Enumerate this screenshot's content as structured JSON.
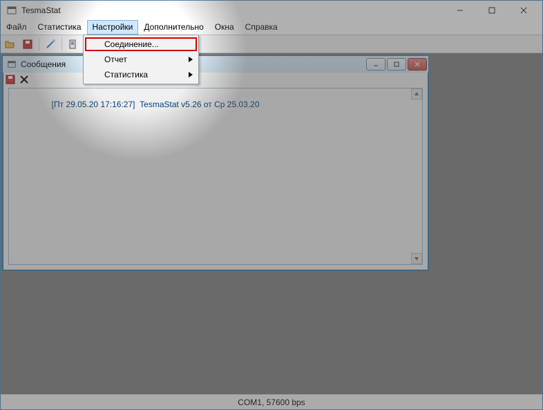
{
  "window": {
    "title": "TesmaStat",
    "buttons": {
      "min": "−",
      "max": "▢",
      "close": "✕"
    }
  },
  "menubar": {
    "items": [
      "Файл",
      "Статистика",
      "Настройки",
      "Дополнительно",
      "Окна",
      "Справка"
    ],
    "activeIndex": 2
  },
  "dropdown": {
    "items": [
      {
        "label": "Соединение...",
        "hasSub": false,
        "highlighted": true
      },
      {
        "label": "Отчет",
        "hasSub": true
      },
      {
        "label": "Статистика",
        "hasSub": true
      }
    ]
  },
  "toolbar": {
    "icons": [
      "open-icon",
      "save-icon",
      "sep",
      "wand-icon",
      "sep",
      "device-icon",
      "screen-icon",
      "sep",
      "sep",
      "type-icon",
      "info-icon",
      "image-icon",
      "sep"
    ]
  },
  "child": {
    "title": "Сообщения",
    "logLine": "[Пт 29.05.20 17:16:27]  TesmaStat v5.26 от Ср 25.03.20"
  },
  "status": {
    "text": "COM1, 57600 bps"
  }
}
